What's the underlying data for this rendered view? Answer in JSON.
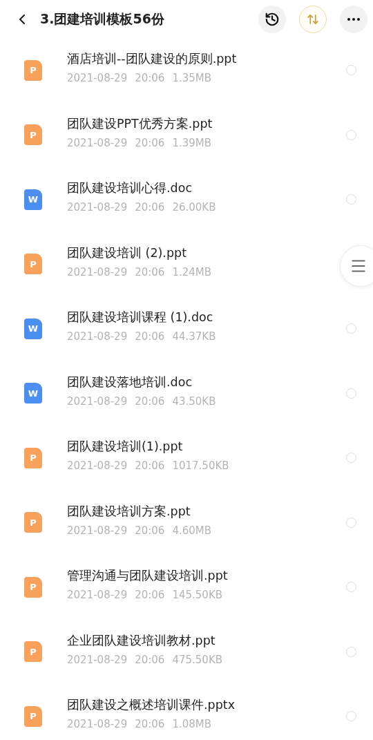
{
  "header": {
    "title": "3.团建培训模板56份"
  },
  "files": [
    {
      "kind": "ppt",
      "icon_letter": "P",
      "name": "酒店培训--团队建设的原则.ppt",
      "date": "2021-08-29",
      "time": "20:06",
      "size": "1.35MB",
      "selected": false
    },
    {
      "kind": "ppt",
      "icon_letter": "P",
      "name": "团队建设PPT优秀方案.ppt",
      "date": "2021-08-29",
      "time": "20:06",
      "size": "1.39MB",
      "selected": false
    },
    {
      "kind": "doc",
      "icon_letter": "W",
      "name": "团队建设培训心得.doc",
      "date": "2021-08-29",
      "time": "20:06",
      "size": "26.00KB",
      "selected": false
    },
    {
      "kind": "ppt",
      "icon_letter": "P",
      "name": "团队建设培训 (2).ppt",
      "date": "2021-08-29",
      "time": "20:06",
      "size": "1.24MB"
    },
    {
      "kind": "doc",
      "icon_letter": "W",
      "name": "团队建设培训课程 (1).doc",
      "date": "2021-08-29",
      "time": "20:06",
      "size": "44.37KB",
      "selected": false
    },
    {
      "kind": "doc",
      "icon_letter": "W",
      "name": "团队建设落地培训.doc",
      "date": "2021-08-29",
      "time": "20:06",
      "size": "43.50KB",
      "selected": false
    },
    {
      "kind": "ppt",
      "icon_letter": "P",
      "name": "团队建设培训(1).ppt",
      "date": "2021-08-29",
      "time": "20:06",
      "size": "1017.50KB",
      "selected": false
    },
    {
      "kind": "ppt",
      "icon_letter": "P",
      "name": "团队建设培训方案.ppt",
      "date": "2021-08-29",
      "time": "20:06",
      "size": "4.60MB",
      "selected": false
    },
    {
      "kind": "ppt",
      "icon_letter": "P",
      "name": "管理沟通与团队建设培训.ppt",
      "date": "2021-08-29",
      "time": "20:06",
      "size": "145.50KB",
      "selected": false
    },
    {
      "kind": "ppt",
      "icon_letter": "P",
      "name": "企业团队建设培训教材.ppt",
      "date": "2021-08-29",
      "time": "20:06",
      "size": "475.50KB",
      "selected": false
    },
    {
      "kind": "ppt",
      "icon_letter": "P",
      "name": "团队建设之概述培训课件.pptx",
      "date": "2021-08-29",
      "time": "20:06",
      "size": "1.08MB",
      "selected": false
    }
  ]
}
